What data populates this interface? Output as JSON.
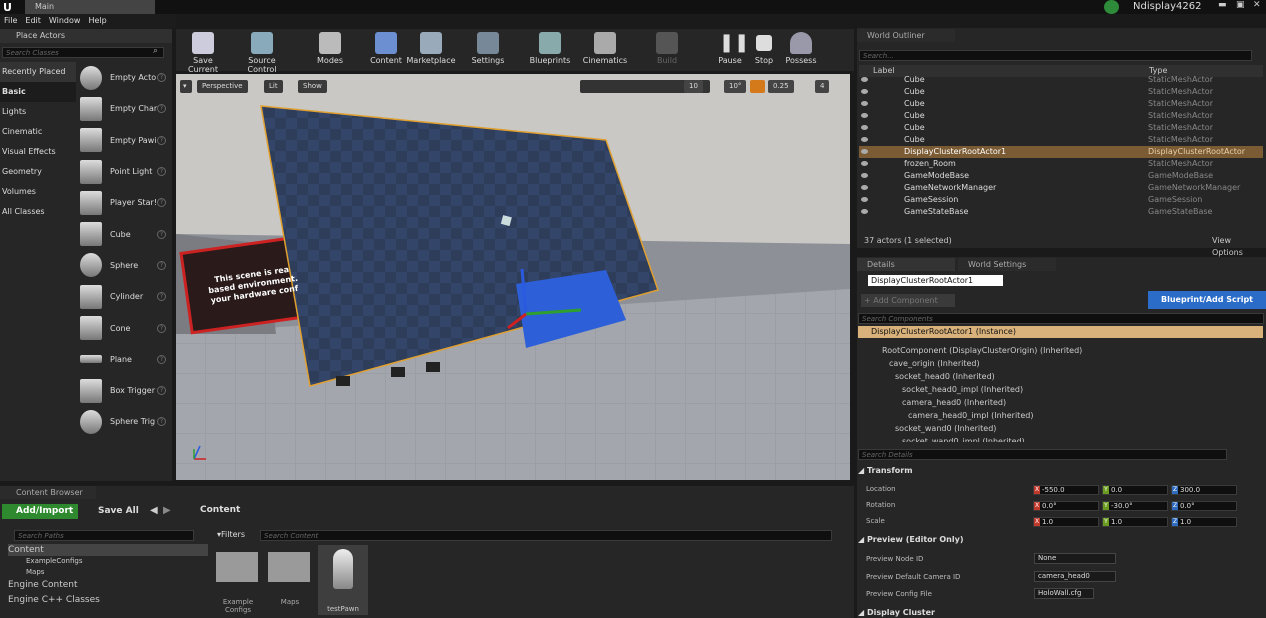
{
  "window": {
    "tab": "Main",
    "project": "Ndisplay4262"
  },
  "menu": [
    "File",
    "Edit",
    "Window",
    "Help"
  ],
  "place_actors": {
    "title": "Place Actors",
    "search_placeholder": "Search Classes",
    "categories": [
      "Recently Placed",
      "Basic",
      "Lights",
      "Cinematic",
      "Visual Effects",
      "Geometry",
      "Volumes",
      "All Classes"
    ],
    "active_category": "Basic",
    "items": [
      "Empty Acto",
      "Empty Char",
      "Empty Pawi",
      "Point Light",
      "Player Star!",
      "Cube",
      "Sphere",
      "Cylinder",
      "Cone",
      "Plane",
      "Box Trigger",
      "Sphere Trig"
    ]
  },
  "toolbar": {
    "buttons": [
      "Save Current",
      "Source Control",
      "Modes",
      "Content",
      "Marketplace",
      "Settings",
      "Blueprints",
      "Cinematics",
      "Build",
      "Pause",
      "Stop",
      "Possess"
    ]
  },
  "viewport": {
    "perspective": "Perspective",
    "lit": "Lit",
    "show": "Show",
    "grid_snap": "10",
    "rot_snap": "10°",
    "scale_snap": "0.25",
    "cam_speed": "4",
    "overlay_text_1": "This scene is rea",
    "overlay_text_2": "based environment.",
    "overlay_text_3": "your hardware conf"
  },
  "outliner": {
    "title": "World Outliner",
    "search_placeholder": "Search...",
    "col_label": "Label",
    "col_type": "Type",
    "rows": [
      {
        "label": "Cube",
        "type": "StaticMeshActor"
      },
      {
        "label": "Cube",
        "type": "StaticMeshActor"
      },
      {
        "label": "Cube",
        "type": "StaticMeshActor"
      },
      {
        "label": "Cube",
        "type": "StaticMeshActor"
      },
      {
        "label": "Cube",
        "type": "StaticMeshActor"
      },
      {
        "label": "Cube",
        "type": "StaticMeshActor"
      },
      {
        "label": "DisplayClusterRootActor1",
        "type": "DisplayClusterRootActor"
      },
      {
        "label": "frozen_Room",
        "type": "StaticMeshActor"
      },
      {
        "label": "GameModeBase",
        "type": "GameModeBase"
      },
      {
        "label": "GameNetworkManager",
        "type": "GameNetworkManager"
      },
      {
        "label": "GameSession",
        "type": "GameSession"
      },
      {
        "label": "GameStateBase",
        "type": "GameStateBase"
      }
    ],
    "selected_index": 6,
    "status": "37 actors (1 selected)",
    "view_options": "View Options"
  },
  "details": {
    "tab_details": "Details",
    "tab_world": "World Settings",
    "actor_name": "DisplayClusterRootActor1",
    "add_component": "+ Add Component",
    "blueprint_button": "Blueprint/Add Script",
    "search_components": "Search Components",
    "instance": "DisplayClusterRootActor1 (Instance)",
    "tree": [
      "RootComponent (DisplayClusterOrigin) (Inherited)",
      "cave_origin (Inherited)",
      "socket_head0 (Inherited)",
      "socket_head0_impl (Inherited)",
      "camera_head0 (Inherited)",
      "camera_head0_impl (Inherited)",
      "socket_wand0 (Inherited)",
      "socket_wand0_impl (Inherited)"
    ],
    "search_details": "Search Details",
    "transform": "Transform",
    "location": {
      "label": "Location",
      "x": "-550.0",
      "y": "0.0",
      "z": "300.0"
    },
    "rotation": {
      "label": "Rotation",
      "x": "0.0°",
      "y": "-30.0°",
      "z": "0.0°"
    },
    "scale": {
      "label": "Scale",
      "x": "1.0",
      "y": "1.0",
      "z": "1.0"
    },
    "preview_section": "Preview (Editor Only)",
    "preview_node_label": "Preview Node ID",
    "preview_node_value": "None",
    "preview_cam_label": "Preview Default Camera ID",
    "preview_cam_value": "camera_head0",
    "preview_cfg_label": "Preview Config File",
    "preview_cfg_value": "HoloWall.cfg",
    "display_cluster": "Display Cluster"
  },
  "content_browser": {
    "title": "Content Browser",
    "add_import": "Add/Import",
    "save_all": "Save All",
    "path": "Content",
    "search_paths": "Search Paths",
    "filters": "Filters",
    "search_content": "Search Content",
    "tree": [
      "Content",
      "ExampleConfigs",
      "Maps",
      "Engine Content",
      "Engine C++ Classes"
    ],
    "assets": [
      "Example Configs",
      "Maps",
      "testPawn"
    ]
  },
  "colors": {
    "accent": "#d8b27a",
    "selected": "#7b5b33",
    "blueprint_btn": "#2a6cc8"
  }
}
